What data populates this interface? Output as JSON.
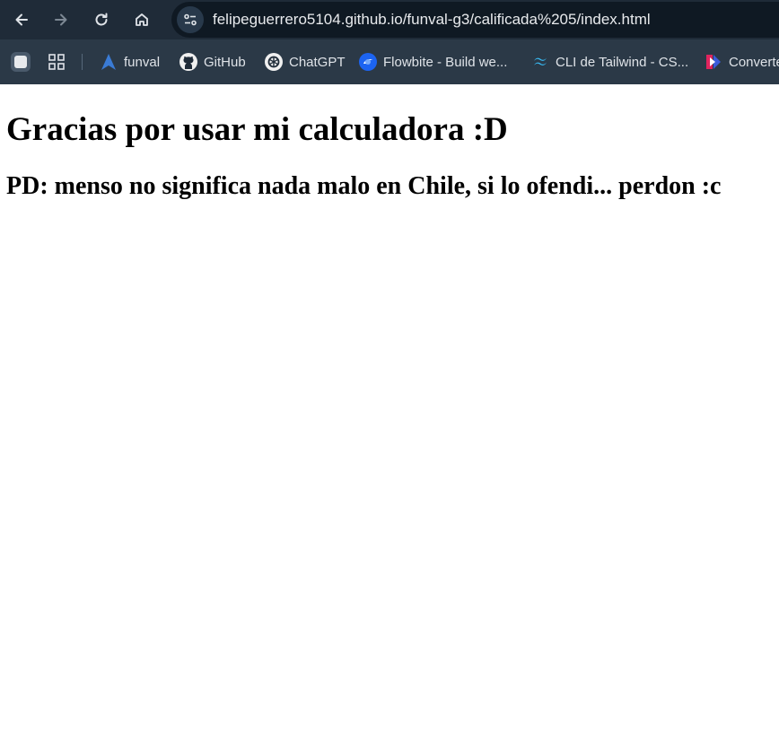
{
  "browser": {
    "url": "felipeguerrero5104.github.io/funval-g3/calificada%205/index.html",
    "bookmarks": [
      {
        "label": "funval",
        "icon": "funval-logo-icon"
      },
      {
        "label": "GitHub",
        "icon": "github-icon"
      },
      {
        "label": "ChatGPT",
        "icon": "chatgpt-icon"
      },
      {
        "label": "Flowbite - Build we...",
        "icon": "flowbite-icon"
      },
      {
        "label": "CLI de Tailwind - CS...",
        "icon": "tailwind-icon"
      },
      {
        "label": "Converte",
        "icon": "converter-icon"
      }
    ]
  },
  "page": {
    "heading": "Gracias por usar mi calculadora :D",
    "subheading": "PD: menso no significa nada malo en Chile, si lo ofendi... perdon :c"
  },
  "colors": {
    "toolbar": "#1f2b38",
    "omnibox": "#0f1923",
    "bookmarks_bar": "#2b3947",
    "page_bg": "#ffffff"
  }
}
